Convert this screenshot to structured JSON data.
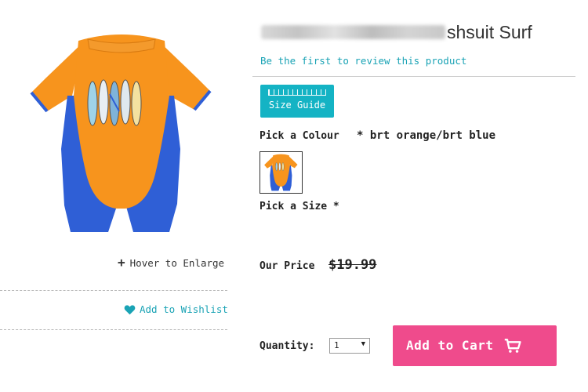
{
  "product": {
    "title_visible": "shsuit Surf",
    "image_alt": "orange/blue surf suit",
    "hover_enlarge": "Hover to Enlarge",
    "wishlist": "Add to Wishlist",
    "review_link": "Be the first to review this product",
    "size_guide": "Size Guide"
  },
  "options": {
    "colour_label": "Pick a Colour",
    "colour_required": "*",
    "colour_value": "brt orange/brt blue",
    "size_label": "Pick a Size",
    "size_required": "*"
  },
  "price": {
    "label": "Our Price",
    "value": "$19.99"
  },
  "cart": {
    "quantity_label": "Quantity:",
    "quantity_value": "1",
    "button_label": "Add to Cart"
  },
  "colors": {
    "accent_teal": "#14b3c4",
    "link_teal": "#1aa3b5",
    "cart_pink": "#ef4b8c",
    "suit_orange": "#f7941d",
    "suit_blue": "#2f5fd6"
  },
  "icons": [
    "plus-icon",
    "heart-icon",
    "ruler-icon",
    "cart-icon",
    "dropdown-arrow-icon"
  ]
}
